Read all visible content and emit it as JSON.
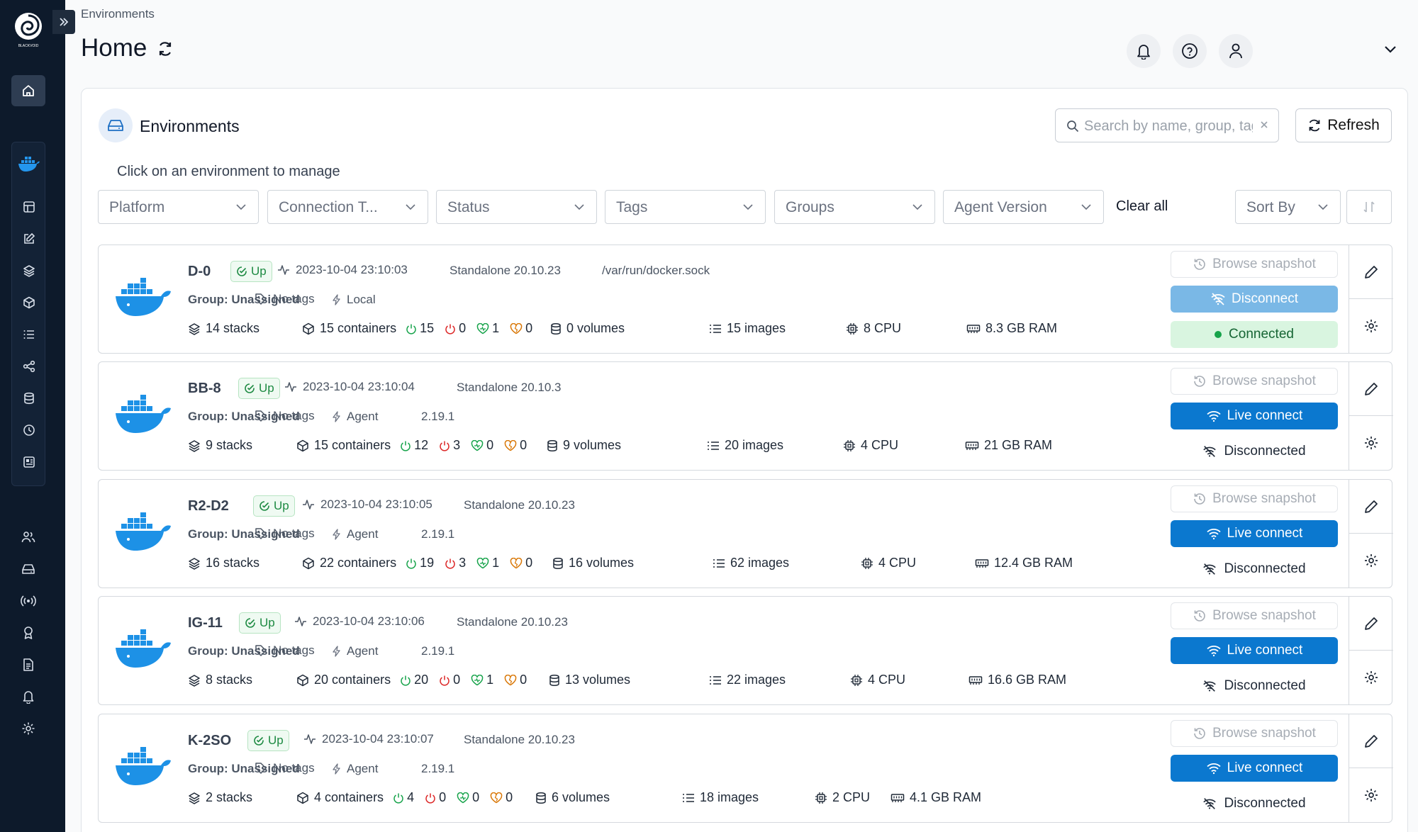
{
  "sidebar": {
    "logo_text": "BLACKVOID",
    "expand_icon": "chevrons-right-icon",
    "home_icon": "home-icon",
    "env_icon": "docker-icon",
    "env_items": [
      "dashboard-icon",
      "edit-icon",
      "layers-icon",
      "cube-icon",
      "list-icon",
      "share-icon",
      "database-icon",
      "history-icon",
      "board-icon"
    ],
    "bottom_items": [
      "users-icon",
      "environments-icon",
      "radio-icon",
      "certificate-icon",
      "document-icon",
      "bell-icon",
      "gear-icon"
    ]
  },
  "header": {
    "breadcrumb": "Environments",
    "title": "Home"
  },
  "panel": {
    "title": "Environments",
    "subtitle": "Click on an environment to manage",
    "search_placeholder": "Search by name, group, tag, status, URL...",
    "refresh_label": "Refresh",
    "filters": [
      "Platform",
      "Connection T...",
      "Status",
      "Tags",
      "Groups",
      "Agent Version"
    ],
    "clear_all": "Clear all",
    "sort_label": "Sort By"
  },
  "environments": [
    {
      "name": "D-0",
      "status": "Up",
      "timestamp": "2023-10-04 23:10:03",
      "version": "Standalone 20.10.23",
      "extra": "/var/run/docker.sock",
      "group": "Group: Unassigned",
      "tags": "No tags",
      "type": "Local",
      "agent_version": "",
      "stacks": "14 stacks",
      "containers": "15 containers",
      "running": "15",
      "stopped": "0",
      "healthy": "1",
      "unhealthy": "0",
      "volumes": "0 volumes",
      "images": "15 images",
      "cpu": "8 CPU",
      "ram": "8.3 GB RAM",
      "snapshot": "Browse snapshot",
      "connect": "Disconnect",
      "state": "Connected"
    },
    {
      "name": "BB-8",
      "status": "Up",
      "timestamp": "2023-10-04 23:10:04",
      "version": "Standalone 20.10.3",
      "extra": "",
      "group": "Group: Unassigned",
      "tags": "No tags",
      "type": "Agent",
      "agent_version": "2.19.1",
      "stacks": "9 stacks",
      "containers": "15 containers",
      "running": "12",
      "stopped": "3",
      "healthy": "0",
      "unhealthy": "0",
      "volumes": "9 volumes",
      "images": "20 images",
      "cpu": "4 CPU",
      "ram": "21 GB RAM",
      "snapshot": "Browse snapshot",
      "connect": "Live connect",
      "state": "Disconnected"
    },
    {
      "name": "R2-D2",
      "status": "Up",
      "timestamp": "2023-10-04 23:10:05",
      "version": "Standalone 20.10.23",
      "extra": "",
      "group": "Group: Unassigned",
      "tags": "No tags",
      "type": "Agent",
      "agent_version": "2.19.1",
      "stacks": "16 stacks",
      "containers": "22 containers",
      "running": "19",
      "stopped": "3",
      "healthy": "1",
      "unhealthy": "0",
      "volumes": "16 volumes",
      "images": "62 images",
      "cpu": "4 CPU",
      "ram": "12.4 GB RAM",
      "snapshot": "Browse snapshot",
      "connect": "Live connect",
      "state": "Disconnected"
    },
    {
      "name": "IG-11",
      "status": "Up",
      "timestamp": "2023-10-04 23:10:06",
      "version": "Standalone 20.10.23",
      "extra": "",
      "group": "Group: Unassigned",
      "tags": "No tags",
      "type": "Agent",
      "agent_version": "2.19.1",
      "stacks": "8 stacks",
      "containers": "20 containers",
      "running": "20",
      "stopped": "0",
      "healthy": "1",
      "unhealthy": "0",
      "volumes": "13 volumes",
      "images": "22 images",
      "cpu": "4 CPU",
      "ram": "16.6 GB RAM",
      "snapshot": "Browse snapshot",
      "connect": "Live connect",
      "state": "Disconnected"
    },
    {
      "name": "K-2SO",
      "status": "Up",
      "timestamp": "2023-10-04 23:10:07",
      "version": "Standalone 20.10.23",
      "extra": "",
      "group": "Group: Unassigned",
      "tags": "No tags",
      "type": "Agent",
      "agent_version": "2.19.1",
      "stacks": "2 stacks",
      "containers": "4 containers",
      "running": "4",
      "stopped": "0",
      "healthy": "0",
      "unhealthy": "0",
      "volumes": "6 volumes",
      "images": "18 images",
      "cpu": "2 CPU",
      "ram": "4.1 GB RAM",
      "snapshot": "Browse snapshot",
      "connect": "Live connect",
      "state": "Disconnected"
    }
  ],
  "colors": {
    "accent": "#0b78cf",
    "sidebar": "#0d1a2b",
    "up_green": "#1d8a42",
    "docker_blue": "#1d91e6"
  }
}
